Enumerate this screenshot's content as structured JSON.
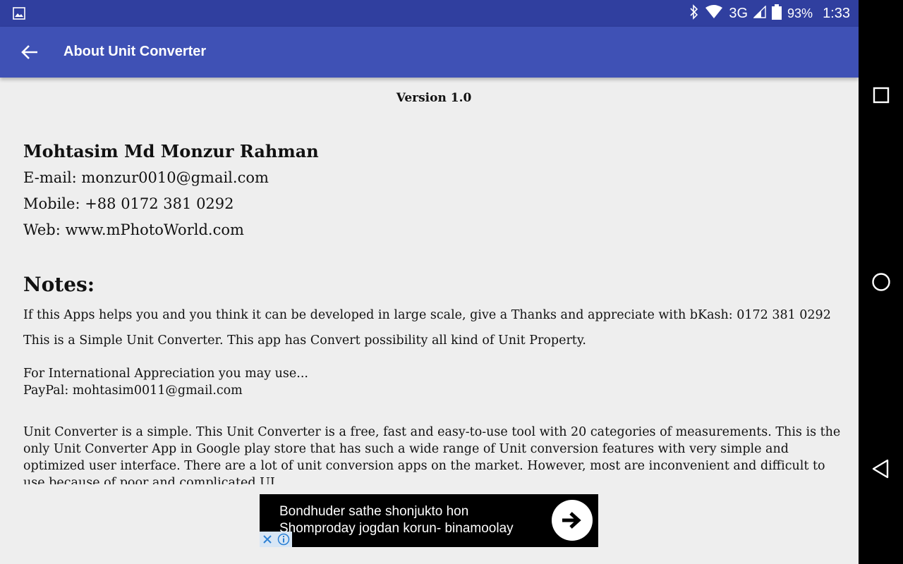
{
  "status_bar": {
    "battery": "93%",
    "time": "1:33",
    "network": "3G"
  },
  "toolbar": {
    "title": "About Unit Converter"
  },
  "about": {
    "version": "Version 1.0",
    "author_name": "Mohtasim Md Monzur Rahman",
    "email": "E-mail: monzur0010@gmail.com",
    "mobile": "Mobile: +88 0172 381 0292",
    "web": "Web: www.mPhotoWorld.com",
    "notes_heading": "Notes:",
    "note1": "If this Apps helps you and you think it can be developed in large scale, give a Thanks and appreciate with bKash: 0172 381 0292",
    "note2": "This is a Simple Unit Converter. This app has Convert possibility all kind of Unit Property.",
    "intl_line1": "For International Appreciation you may use...",
    "intl_line2": "PayPal: mohtasim0011@gmail.com",
    "description": "Unit Converter is a simple. This Unit Converter is a free, fast and easy-to-use tool with 20 categories of measurements. This is the only Unit Converter App in Google play store that has such a wide range of Unit conversion features with very simple and optimized user interface. There are a lot of unit conversion apps on the market. However, most are inconvenient and difficult to use because of poor and complicated UI."
  },
  "ad": {
    "line1": "Bondhuder sathe shonjukto hon",
    "line2": "Shomproday jogdan korun- binamoolay"
  },
  "colors": {
    "status_bar": "#303f9f",
    "toolbar": "#3f51b5",
    "background": "#eeeeee"
  }
}
